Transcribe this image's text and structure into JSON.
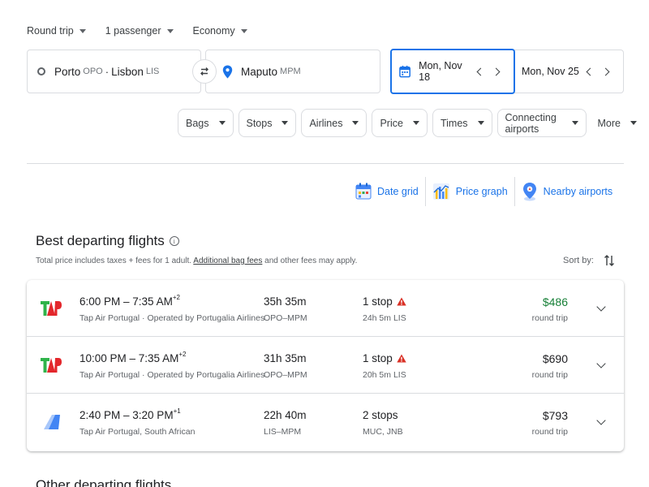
{
  "trip_selectors": {
    "trip_type": "Round trip",
    "passengers": "1 passenger",
    "cabin": "Economy"
  },
  "search": {
    "from": {
      "city": "Porto",
      "code": "OPO",
      "separator": "·",
      "city2": "Lisbon",
      "code2": "LIS"
    },
    "to": {
      "city": "Maputo",
      "code": "MPM"
    },
    "depart_date": "Mon, Nov 18",
    "return_date": "Mon, Nov 25"
  },
  "filters": [
    "Bags",
    "Stops",
    "Airlines",
    "Price",
    "Times",
    "Connecting airports",
    "More"
  ],
  "tools": {
    "date_grid": "Date grid",
    "price_graph": "Price graph",
    "nearby_airports": "Nearby airports"
  },
  "results": {
    "title": "Best departing flights",
    "info_glyph": "i",
    "note_prefix": "Total price includes taxes + fees for 1 adult. ",
    "note_link": "Additional bag fees",
    "note_suffix": " and other fees may apply.",
    "sort_label": "Sort by:",
    "flights": [
      {
        "logo": "tap-logo",
        "times": "6:00 PM – 7:35 AM",
        "day_offset": "+2",
        "airline": "Tap Air Portugal · Operated by Portugalia Airlines",
        "duration": "35h 35m",
        "route": "OPO–MPM",
        "stops": "1 stop",
        "warning": true,
        "layover": "24h 5m LIS",
        "price": "$486",
        "price_note": "round trip",
        "price_highlight": true
      },
      {
        "logo": "tap-logo",
        "times": "10:00 PM – 7:35 AM",
        "day_offset": "+2",
        "airline": "Tap Air Portugal · Operated by Portugalia Airlines",
        "duration": "31h 35m",
        "route": "OPO–MPM",
        "stops": "1 stop",
        "warning": true,
        "layover": "20h 5m LIS",
        "price": "$690",
        "price_note": "round trip",
        "price_highlight": false
      },
      {
        "logo": "multi-airline-logo",
        "times": "2:40 PM – 3:20 PM",
        "day_offset": "+1",
        "airline": "Tap Air Portugal, South African",
        "duration": "22h 40m",
        "route": "LIS–MPM",
        "stops": "2 stops",
        "warning": false,
        "layover": "MUC, JNB",
        "price": "$793",
        "price_note": "round trip",
        "price_highlight": false
      }
    ]
  },
  "other_title": "Other departing flights",
  "colors": {
    "accent": "#1a73e8",
    "price_green": "#188038",
    "warning_red": "#d93025",
    "tap_green": "#2fb34a",
    "tap_red": "#e3262b"
  }
}
